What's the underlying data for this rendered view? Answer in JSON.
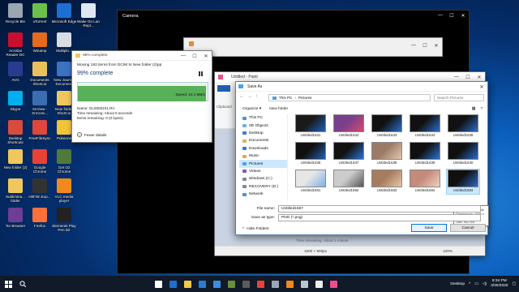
{
  "desktop_icons": [
    {
      "label": "Recycle Bin",
      "color": "#9aa6b2"
    },
    {
      "label": "uTorrent",
      "color": "#6cc04a"
    },
    {
      "label": "Microsoft Edge",
      "color": "#1d6fd1"
    },
    {
      "label": "Wake On Lan Repl...",
      "color": "#dfe8f2"
    },
    {
      "label": "Acrobat Reader DC",
      "color": "#c8102e"
    },
    {
      "label": "Winamp",
      "color": "#e56a1b"
    },
    {
      "label": "Multiplo...",
      "color": "#d8dde3"
    },
    {
      "label": "AVG",
      "color": "#2a3b8f"
    },
    {
      "label": "Documents Shortcut",
      "color": "#e8c15a"
    },
    {
      "label": "New Journal Document",
      "color": "#3b73c2"
    },
    {
      "label": "Skype",
      "color": "#00aff0"
    },
    {
      "label": "XnView - XnConv...",
      "color": "#3c6db0"
    },
    {
      "label": "New folder Shortcut",
      "color": "#f0c75e"
    },
    {
      "label": "Desktop Shortcuts",
      "color": "#d94c3d"
    },
    {
      "label": "FreeFileSync",
      "color": "#e0463c"
    },
    {
      "label": "Pokeone",
      "color": "#f1c43a"
    },
    {
      "label": "New folder (2)",
      "color": "#f0c75e"
    },
    {
      "label": "Google Chrome",
      "color": "#e94235"
    },
    {
      "label": "Get Oz Chrome",
      "color": "#4f7a3a"
    },
    {
      "label": "Sublimina... folder",
      "color": "#f0c75e"
    },
    {
      "label": "HitFilm Exp...",
      "color": "#333"
    },
    {
      "label": "VLC media player",
      "color": "#f08a1c"
    },
    {
      "label": "Tor Browser",
      "color": "#6f3d98"
    },
    {
      "label": "Firefox",
      "color": "#ff7139"
    },
    {
      "label": "Elements Play Pen Dir",
      "color": "#222"
    }
  ],
  "sidebar_icons": [
    {
      "label": "Recycle Bin",
      "color": "#9aa6b2"
    },
    {
      "label": "Acrobat Reader DC",
      "color": "#c8102e"
    },
    {
      "label": "AVG",
      "color": "#2a3b8f"
    },
    {
      "label": "Skype",
      "color": "#00aff0"
    }
  ],
  "camera": {
    "title": "Camera"
  },
  "copy_dialog": {
    "title": "99% complete",
    "moving": "Moving 192 items from DCIM to New folder (2)pp",
    "moving_from": "DCIM",
    "moving_to": "New folder (2)pp",
    "percent_text": "99% complete",
    "progress": 0.99,
    "speed": "Speed: 10.1 MB/s",
    "name": "Name: GL0000101.RV",
    "time": "Time remaining: About 5 seconds",
    "items": "Items remaining: 0 (0 bytes)",
    "fewer": "Fewer details"
  },
  "paint": {
    "title": "Untitled - Paint",
    "tab_clipboard": "Clipboard",
    "status_remaining": "Time remaining: About 1 minute",
    "status_size": "1600 × 900px",
    "zoom": "100%"
  },
  "save_as": {
    "title": "Save As",
    "breadcrumb": [
      "This PC",
      "Pictures"
    ],
    "search_placeholder": "Search Pictures",
    "organize": "Organize ▾",
    "new_folder": "New folder",
    "nav_items": [
      {
        "label": "This PC",
        "color": "#4b8fd4"
      },
      {
        "label": "3D Objects",
        "color": "#6ab0e8"
      },
      {
        "label": "Desktop",
        "color": "#3a7bd5"
      },
      {
        "label": "Documents",
        "color": "#d9b35a"
      },
      {
        "label": "Downloads",
        "color": "#2b7cd3"
      },
      {
        "label": "Music",
        "color": "#e4a93a"
      },
      {
        "label": "Pictures",
        "color": "#4fa0e0"
      },
      {
        "label": "Videos",
        "color": "#7a5bbf"
      },
      {
        "label": "Windows (C:)",
        "color": "#7a8a99"
      },
      {
        "label": "RECOVERY (D:)",
        "color": "#7a8a99"
      },
      {
        "label": "Network",
        "color": "#4b8fd4"
      }
    ],
    "thumbs": [
      {
        "name": "Untitled1631",
        "c1": "#1a1a1a",
        "c2": "#1e5fb8"
      },
      {
        "name": "Untitled1632",
        "c1": "#7a3f8c",
        "c2": "#d44a6a"
      },
      {
        "name": "Untitled1633",
        "c1": "#111",
        "c2": "#2a6fc9"
      },
      {
        "name": "Untitled1634",
        "c1": "#111",
        "c2": "#2a6fc9"
      },
      {
        "name": "Untitled1635",
        "c1": "#111",
        "c2": "#2a6fc9"
      },
      {
        "name": "Untitled1636",
        "c1": "#101010",
        "c2": "#2561b0"
      },
      {
        "name": "Untitled1637",
        "c1": "#121212",
        "c2": "#2c73d1"
      },
      {
        "name": "Untitled1638",
        "c1": "#9b7b68",
        "c2": "#e3c9b0"
      },
      {
        "name": "Untitled1639",
        "c1": "#101010",
        "c2": "#2c73d1"
      },
      {
        "name": "Untitled1640",
        "c1": "#101010",
        "c2": "#2a6ccd"
      },
      {
        "name": "Untitled1681",
        "c1": "#e6e6e6",
        "c2": "#7cb0e8"
      },
      {
        "name": "Untitled1682",
        "c1": "#ccc",
        "c2": "#555"
      },
      {
        "name": "Untitled1683",
        "c1": "#a77b5e",
        "c2": "#e7c6a8"
      },
      {
        "name": "Untitled1684",
        "c1": "#c48a7a",
        "c2": "#f0cfc0"
      },
      {
        "name": "Untitled1684",
        "c1": "#101010",
        "c2": "#2a6ccd"
      }
    ],
    "tooltip": [
      "Item type: PNG File",
      "Dimensions: 1600 x 900",
      "Size: 962 KB"
    ],
    "file_name_label": "File name:",
    "file_name": "Untitled1657",
    "save_type_label": "Save as type:",
    "save_type": "PNG (*.png)",
    "hide_folders": "Hide Folders",
    "save": "Save",
    "cancel": "Cancel"
  },
  "taskbar": {
    "apps": [
      {
        "name": "task-view",
        "color": "#ffffff"
      },
      {
        "name": "edge",
        "color": "#1d6fd1"
      },
      {
        "name": "file-explorer",
        "color": "#f2c84b"
      },
      {
        "name": "store",
        "color": "#2b7cd3"
      },
      {
        "name": "mail",
        "color": "#3c8de0"
      },
      {
        "name": "minecraft",
        "color": "#6a8f3a"
      },
      {
        "name": "photos",
        "color": "#5c5c5c"
      },
      {
        "name": "chrome",
        "color": "#e94235"
      },
      {
        "name": "sketch",
        "color": "#9aa6b2"
      },
      {
        "name": "vlc",
        "color": "#f08a1c"
      },
      {
        "name": "steam",
        "color": "#b9c6d3"
      },
      {
        "name": "camera",
        "color": "#eeeeee"
      },
      {
        "name": "paint",
        "color": "#e94f8a"
      }
    ],
    "desktop_label": "Desktop",
    "time": "8:34 PM",
    "date": "3/30/2020"
  }
}
